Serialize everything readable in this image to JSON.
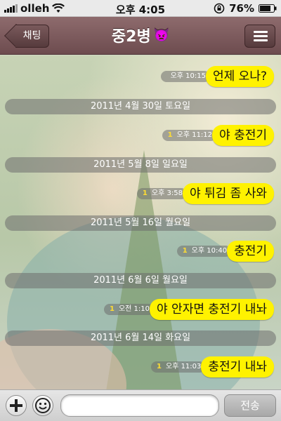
{
  "status_bar": {
    "carrier": "olleh",
    "time": "오후 4:05",
    "battery": "76%",
    "signal_bars": 4,
    "icons": [
      "signal-icon",
      "wifi-icon",
      "rotation-lock-icon",
      "battery-icon"
    ]
  },
  "nav": {
    "back_label": "채팅",
    "title": "중2병",
    "title_emoji": "👿",
    "menu_icon": "menu-icon"
  },
  "messages": [
    {
      "type": "message",
      "unread": "",
      "time": "오후 10:15",
      "text": "언제 오나?"
    },
    {
      "type": "date",
      "text": "2011년 4월 30일 토요일"
    },
    {
      "type": "message",
      "unread": "1",
      "time": "오후 11:12",
      "text": "야 충전기"
    },
    {
      "type": "date",
      "text": "2011년 5월 8일 일요일"
    },
    {
      "type": "message",
      "unread": "1",
      "time": "오후 3:58",
      "text": "야 튀김 좀 사와"
    },
    {
      "type": "date",
      "text": "2011년 5월 16일 월요일"
    },
    {
      "type": "message",
      "unread": "1",
      "time": "오후 10:40",
      "text": "충전기"
    },
    {
      "type": "date",
      "text": "2011년 6월 6일 월요일"
    },
    {
      "type": "message",
      "unread": "1",
      "time": "오전 1:10",
      "text": "야 안자면 충전기 내놔"
    },
    {
      "type": "date",
      "text": "2011년 6월 14일 화요일"
    },
    {
      "type": "message",
      "unread": "1",
      "time": "오후 11:03",
      "text": "충전기 내놔"
    }
  ],
  "toolbar": {
    "add_icon": "plus-icon",
    "emoticon_icon": "smiley-icon",
    "input_value": "",
    "send_label": "전송"
  },
  "colors": {
    "nav_bar": "#7a5a5c",
    "bubble": "#fff200",
    "date_pill": "#6e6e6e"
  }
}
